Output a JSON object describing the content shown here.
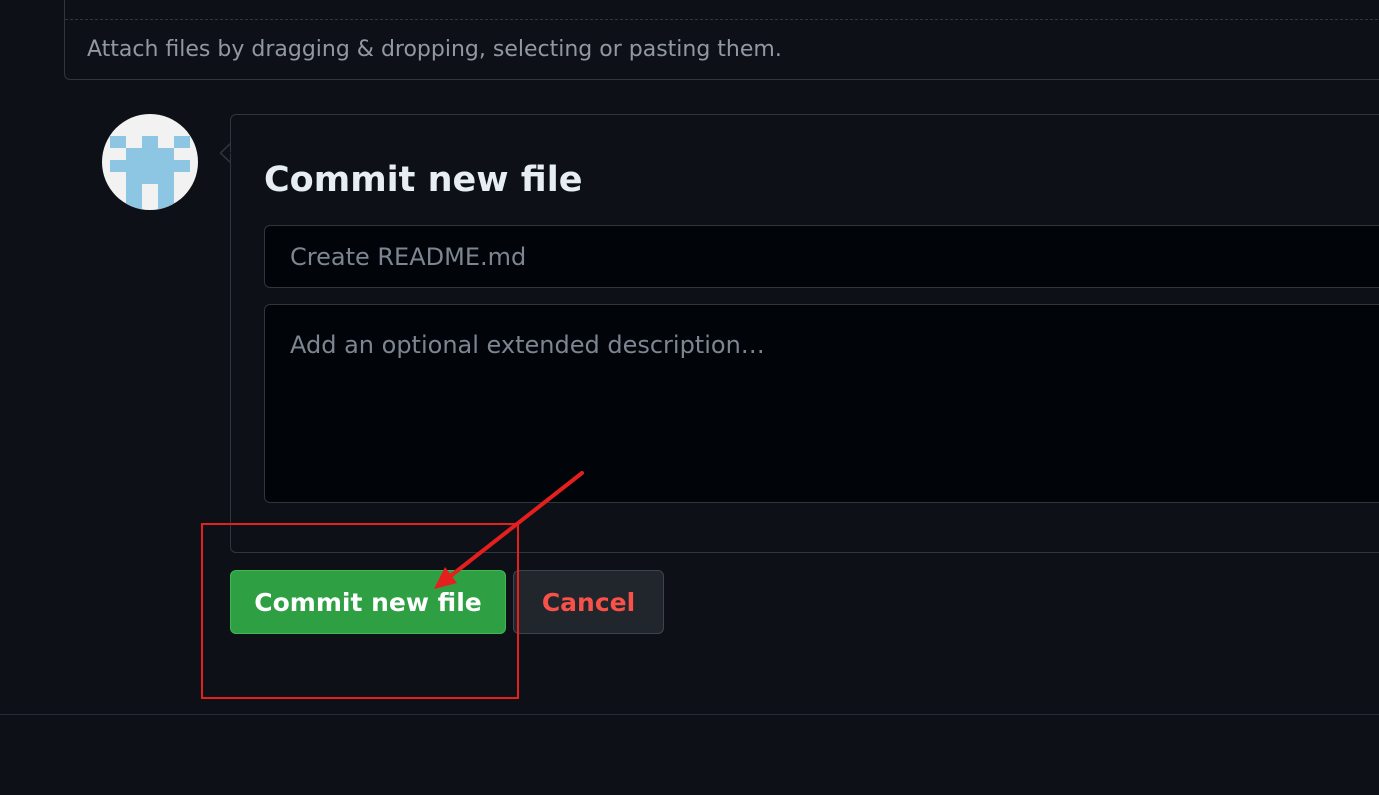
{
  "attach": {
    "hint": "Attach files by dragging & dropping, selecting or pasting them."
  },
  "commit": {
    "title": "Commit new file",
    "summary_placeholder": "Create README.md",
    "summary_value": "",
    "description_placeholder": "Add an optional extended description…",
    "description_value": "",
    "commit_button_label": "Commit new file",
    "cancel_button_label": "Cancel"
  },
  "annotation": {
    "shapes": [
      "highlight-rectangle",
      "arrow"
    ],
    "color": "#e51e1e"
  },
  "colors": {
    "page_background": "#0d1117",
    "input_background": "#010409",
    "border": "#30363d",
    "primary_button": "#2ea043",
    "danger_text": "#f85149",
    "avatar_light": "#f2f2f2",
    "avatar_blue": "#8cc6e3"
  },
  "icons": {
    "avatar": "identicon-avatar"
  }
}
